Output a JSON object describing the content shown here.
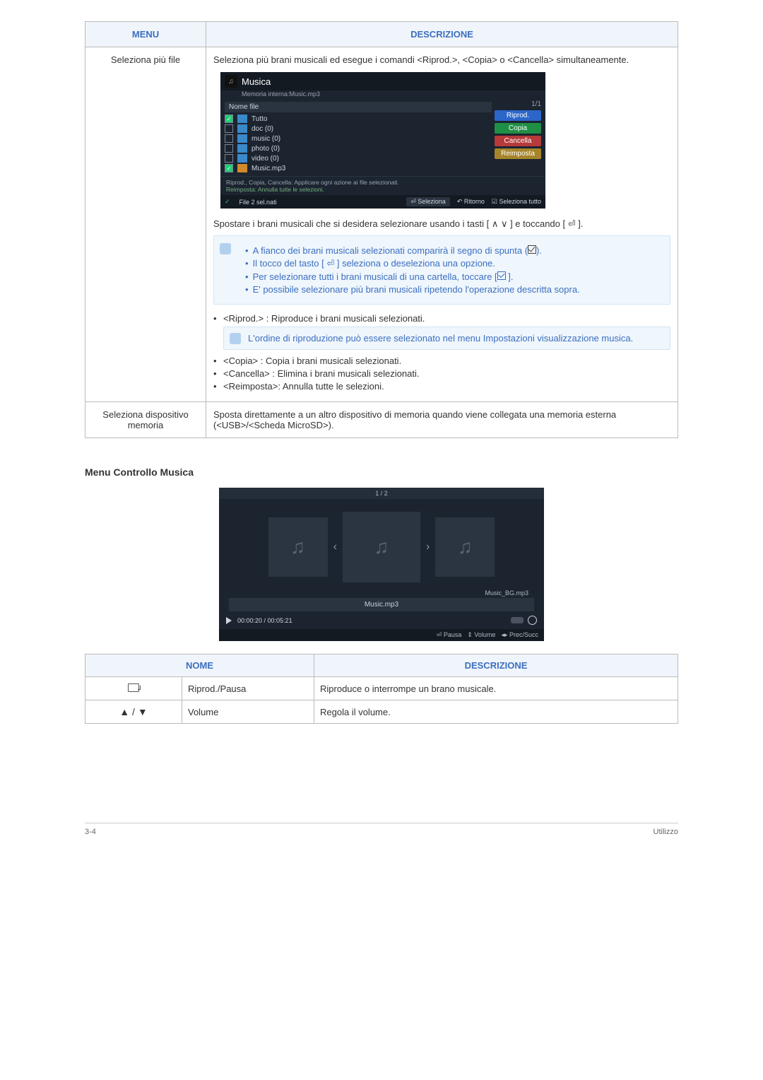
{
  "table1": {
    "header": {
      "menu": "MENU",
      "desc": "DESCRIZIONE"
    },
    "row1": {
      "menu": "Seleziona più file",
      "intro": "Seleziona più brani musicali ed esegue i comandi <Riprod.>, <Copia> o <Cancella> simultaneamente.",
      "shot": {
        "title": "Musica",
        "path": "Memoria interna:Music.mp3",
        "page": "1/1",
        "nomefile": "Nome file",
        "items": [
          "Tutto",
          "doc (0)",
          "music (0)",
          "photo (0)",
          "video (0)",
          "Music.mp3"
        ],
        "btns": {
          "riprod": "Riprod.",
          "copia": "Copia",
          "cancella": "Cancella",
          "reimposta": "Reimposta"
        },
        "note1": "Riprod., Copia, Cancella: Applicare ogni azione ai file selezionati.",
        "note2": "Reimposta: Annulla tutte le selezioni.",
        "foot": {
          "sel": "File 2 sel.nati",
          "seleziona": "Seleziona",
          "ritorno": "Ritorno",
          "seltutto": "Seleziona tutto"
        }
      },
      "moveLine": "Spostare i brani musicali che si desidera selezionare usando i tasti [ ∧ ∨ ] e toccando [ ⏎ ].",
      "tips": [
        "A fianco dei brani musicali selezionati comparirà il segno di spunta (",
        "Il tocco del tasto [ ⏎ ] seleziona o deseleziona una opzione.",
        "Per selezionare tutti i brani musicali di una cartella, toccare [",
        "E' possibile selezionare più brani musicali ripetendo l'operazione descritta sopra."
      ],
      "tip1_end": ").",
      "tip3_end": " ].",
      "li1": "<Riprod.> : Riproduce i brani musicali selezionati.",
      "note2": "L'ordine di riproduzione può essere selezionato nel menu Impostazioni visualizzazione musica.",
      "li2": "<Copia> : Copia i brani musicali selezionati.",
      "li3": "<Cancella> : Elimina i brani musicali selezionati.",
      "li4": "<Reimposta>: Annulla tutte le selezioni."
    },
    "row2": {
      "menu": "Seleziona dispositivo memoria",
      "desc": "Sposta direttamente a un altro dispositivo di memoria quando viene collegata una memoria esterna (<USB>/<Scheda MicroSD>)."
    }
  },
  "sectionTitle": "Menu Controllo Musica",
  "shot2": {
    "page": "1 / 2",
    "label": "Music_BG.mp3",
    "current": "Music.mp3",
    "time": "00:00:20 / 00:05:21",
    "foot": {
      "pausa": "Pausa",
      "volume": "Volume",
      "prec": "Prec/Succ"
    }
  },
  "table2": {
    "header": {
      "nome": "NOME",
      "desc": "DESCRIZIONE"
    },
    "rows": [
      {
        "name": "Riprod./Pausa",
        "desc": "Riproduce o interrompe un brano musicale."
      },
      {
        "name": "Volume",
        "desc": "Regola il volume."
      }
    ]
  },
  "footer": {
    "left": "3-4",
    "right": "Utilizzo"
  }
}
